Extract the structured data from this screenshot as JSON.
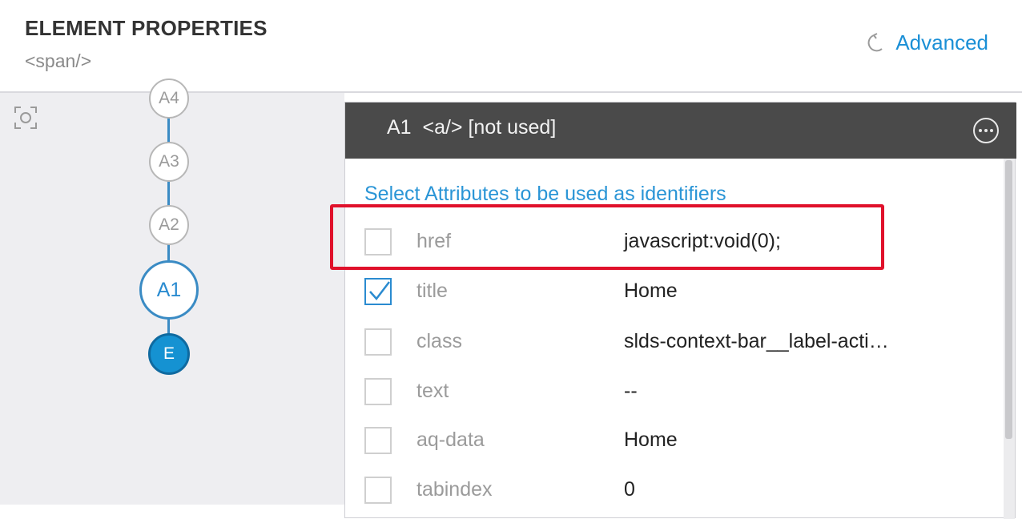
{
  "header": {
    "title": "ELEMENT PROPERTIES",
    "subtitle": "<span/>",
    "advanced_label": "Advanced",
    "advanced_icon": "refresh-icon",
    "link_color": "#1a8fd6"
  },
  "chain": {
    "nodes": [
      {
        "label": "A4"
      },
      {
        "label": "A3"
      },
      {
        "label": "A2"
      },
      {
        "label": "A1"
      },
      {
        "label": "E"
      }
    ],
    "focus_icon": "focus-target-icon"
  },
  "panel": {
    "title": "A1  <a/> [not used]",
    "more_icon": "more-options-icon",
    "select_label": "Select Attributes to be used as identifiers",
    "attributes": [
      {
        "name": "href",
        "value": "javascript:void(0);",
        "checked": false
      },
      {
        "name": "title",
        "value": "Home",
        "checked": true
      },
      {
        "name": "class",
        "value": "slds-context-bar__label-acti…",
        "checked": false
      },
      {
        "name": "text",
        "value": "--",
        "checked": false
      },
      {
        "name": "aq-data",
        "value": "Home",
        "checked": false
      },
      {
        "name": "tabindex",
        "value": "0",
        "checked": false
      }
    ],
    "highlight_color": "#e0112b"
  }
}
